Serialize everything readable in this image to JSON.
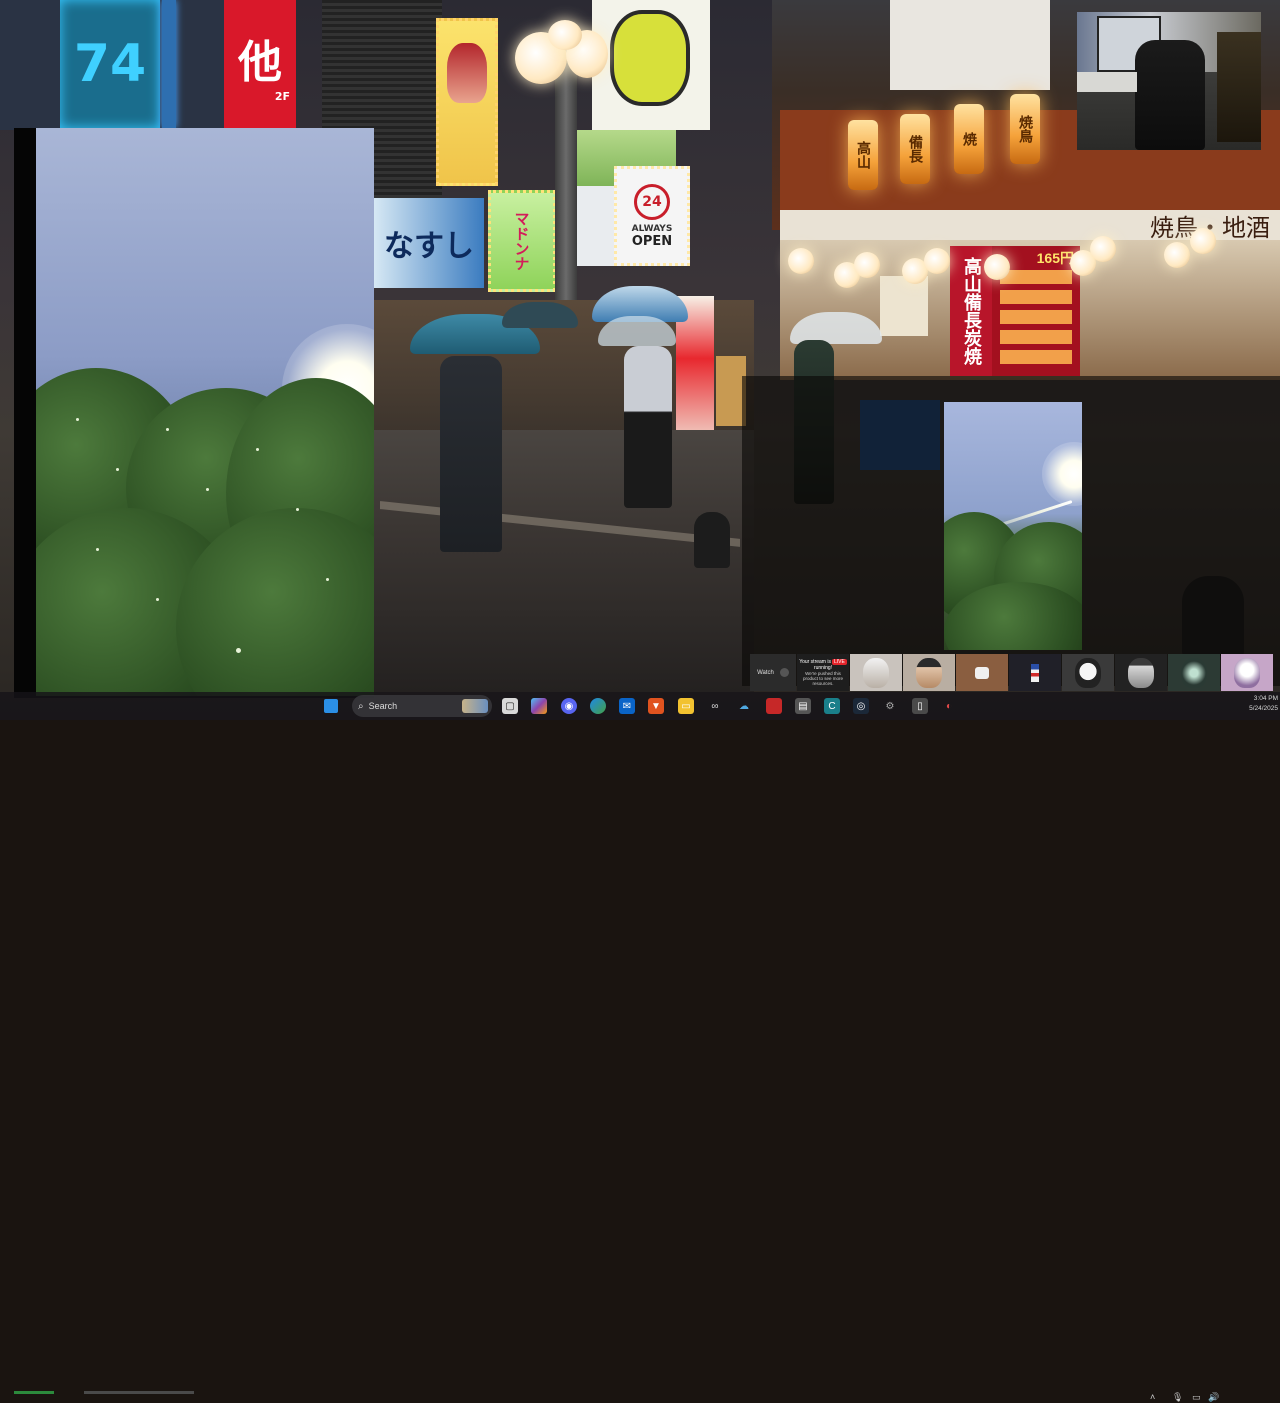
{
  "scene": {
    "signs": {
      "karaoke_numbers": "74",
      "red_sign_char": "他",
      "red_sign_floor": "2F",
      "always_open_number": "24",
      "always_open_line1": "ALWAYS",
      "always_open_line2": "OPEN",
      "nasu_text": "なすし",
      "matsuken_text": "マドンナ",
      "price_tag": "165円",
      "yakitori_banner": "焼鳥・地酒",
      "vertical_banner": "高山備長炭焼",
      "lanterns": [
        "高山",
        "備長",
        "焼",
        "焼鳥"
      ]
    }
  },
  "stream_tiles": {
    "watch_label": "Watch",
    "live_line1": "Your stream is",
    "live_pill": "LIVE",
    "live_line2": "running!",
    "live_line3": "We're pushed this",
    "live_line4": "product to see more",
    "live_line5": "resources."
  },
  "taskbar": {
    "search_placeholder": "Search",
    "time": "3:04 PM",
    "date": "5/24/2025"
  },
  "colors": {
    "taskbar_bg": "#161418",
    "live_red": "#e4242b",
    "lantern_glow": "#f5a23a"
  }
}
